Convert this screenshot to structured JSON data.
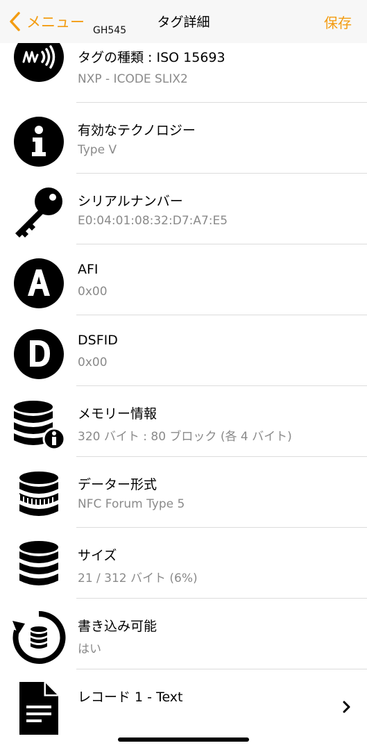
{
  "nav": {
    "back_label": "メニュー",
    "subtitle": "GH545",
    "title": "タグ詳細",
    "save_label": "保存"
  },
  "colors": {
    "accent": "#f39c12",
    "icon": "#000000",
    "secondary_text": "#8a8a8a"
  },
  "rows": [
    {
      "icon": "nfc-signal-icon",
      "title": "タグの種類 : ISO 15693",
      "value": "NXP - ICODE SLIX2"
    },
    {
      "icon": "info-icon",
      "title": "有効なテクノロジー",
      "value": "Type V"
    },
    {
      "icon": "key-icon",
      "title": "シリアルナンバー",
      "value": "E0:04:01:08:32:D7:A7:E5"
    },
    {
      "icon": "letter-a-icon",
      "title": "AFI",
      "value": "0x00"
    },
    {
      "icon": "letter-d-icon",
      "title": "DSFID",
      "value": "0x00"
    },
    {
      "icon": "database-info-icon",
      "title": "メモリー情報",
      "value": "320 バイト : 80 ブロック (各 4 バイト)"
    },
    {
      "icon": "database-format-icon",
      "title": "データー形式",
      "value": "NFC Forum Type 5"
    },
    {
      "icon": "database-icon",
      "title": "サイズ",
      "value": "21 / 312 バイト (6%)"
    },
    {
      "icon": "rewrite-icon",
      "title": "書き込み可能",
      "value": "はい"
    },
    {
      "icon": "document-icon",
      "title": "レコード 1 - Text",
      "value": ""
    }
  ]
}
